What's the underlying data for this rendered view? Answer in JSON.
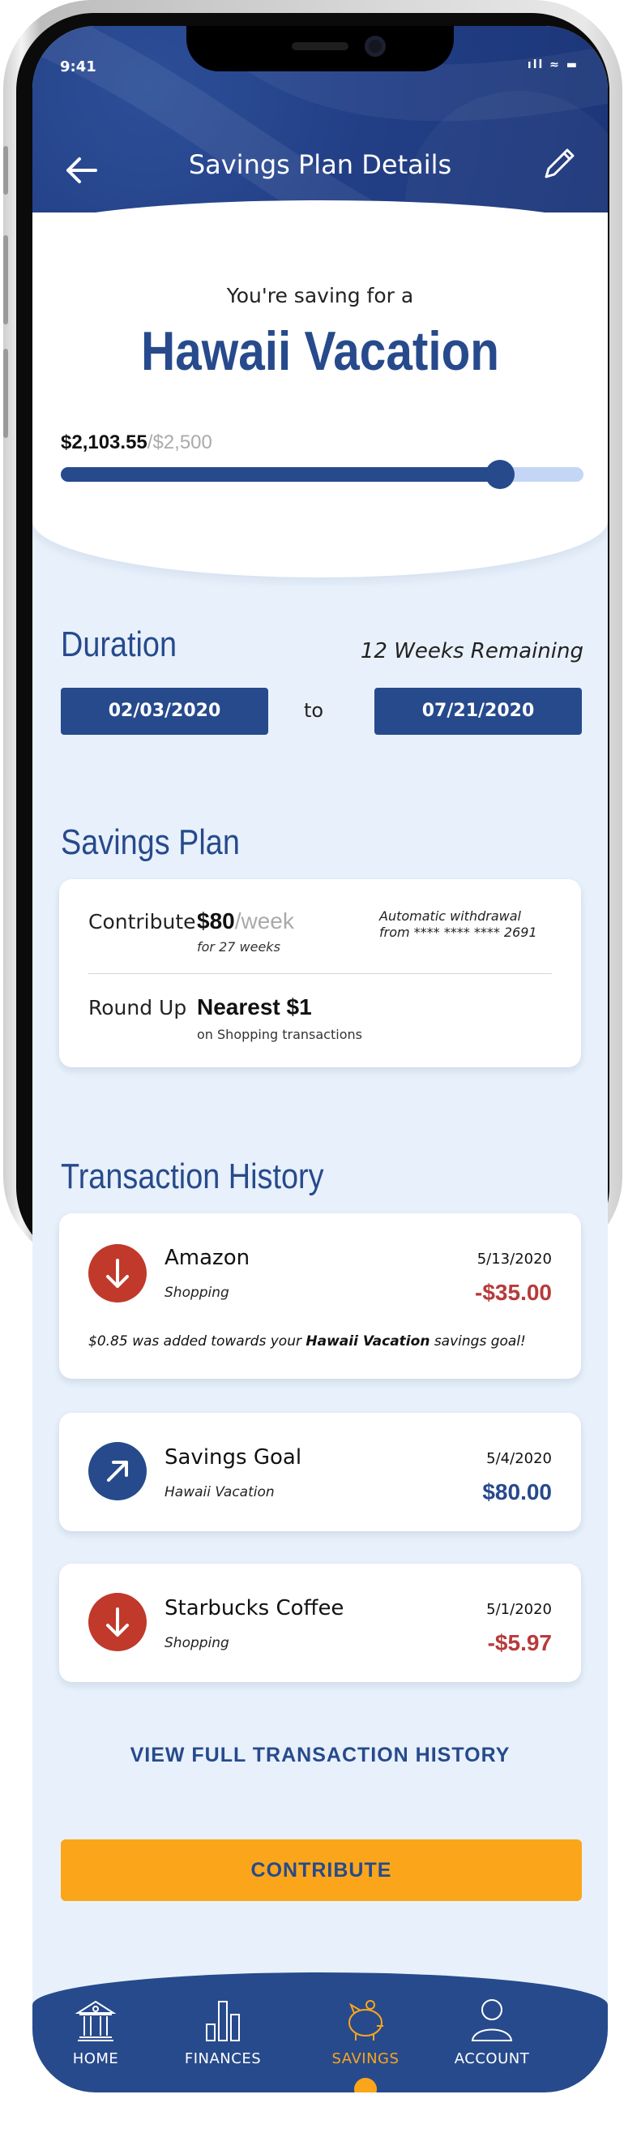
{
  "status": {
    "time": "9:41",
    "icons": "ıll ≈ ▬"
  },
  "header": {
    "title": "Savings Plan Details"
  },
  "goal": {
    "label": "You're saving for a",
    "name": "Hawaii Vacation",
    "saved": "$2,103.55",
    "target": "/$2,500",
    "progress_fraction": 0.84
  },
  "duration": {
    "title": "Duration",
    "remaining": "12 Weeks Remaining",
    "start": "02/03/2020",
    "to": "to",
    "end": "07/21/2020"
  },
  "plan": {
    "title": "Savings Plan",
    "contribute_label": "Contribute",
    "contribute_amount": "$80",
    "contribute_per": "/week",
    "contribute_sub": "for 27 weeks",
    "withdrawal_line1": "Automatic withdrawal",
    "withdrawal_line2": "from **** **** **** 2691",
    "roundup_label": "Round Up",
    "roundup_value": "Nearest $1",
    "roundup_sub": "on Shopping transactions"
  },
  "history": {
    "title": "Transaction History",
    "transactions": [
      {
        "name": "Amazon",
        "category": "Shopping",
        "date": "5/13/2020",
        "amount": "-$35.00"
      },
      {
        "name": "Savings Goal",
        "category": "Hawaii Vacation",
        "date": "5/4/2020",
        "amount": "$80.00"
      },
      {
        "name": "Starbucks Coffee",
        "category": "Shopping",
        "date": "5/1/2020",
        "amount": "-$5.97"
      }
    ],
    "note_pre": "$0.85 was added towards your ",
    "note_goal": "Hawaii Vacation",
    "note_post": " savings goal!",
    "view_full": "VIEW FULL TRANSACTION HISTORY"
  },
  "contribute_button": "CONTRIBUTE",
  "nav": {
    "home": "HOME",
    "finances": "FINANCES",
    "savings": "SAVINGS",
    "account": "ACCOUNT"
  },
  "colors": {
    "primary": "#264a8c",
    "accent": "#fba61a",
    "negative": "#b83a3a",
    "background": "#e8f1fb"
  }
}
